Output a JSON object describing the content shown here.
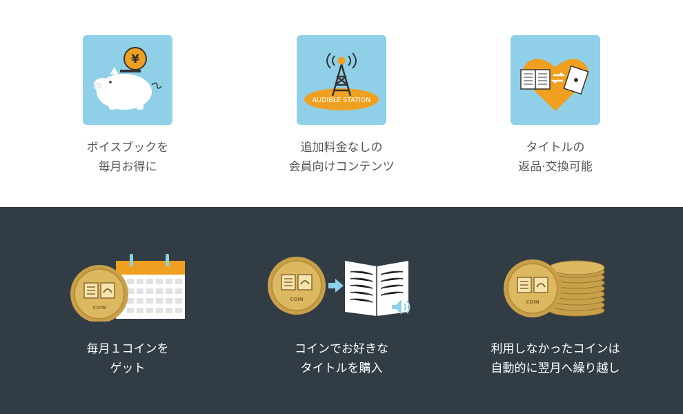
{
  "top_features": [
    {
      "line1": "ボイスブックを",
      "line2": "毎月お得に",
      "icon": "piggy-bank-icon",
      "coin_symbol": "¥"
    },
    {
      "line1": "追加料金なしの",
      "line2": "会員向けコンテンツ",
      "icon": "radio-tower-icon",
      "badge": "AUDIBLE STATION"
    },
    {
      "line1": "タイトルの",
      "line2": "返品·交換可能",
      "icon": "book-exchange-icon"
    }
  ],
  "bottom_features": [
    {
      "line1": "毎月１コインを",
      "line2": "ゲット",
      "icon": "coin-calendar-icon",
      "coin_text": "COIN"
    },
    {
      "line1": "コインでお好きな",
      "line2": "タイトルを購入",
      "icon": "coin-to-book-icon",
      "coin_text": "COIN"
    },
    {
      "line1": "利用しなかったコインは",
      "line2": "自動的に翌月へ繰り越し",
      "icon": "coin-stack-icon",
      "coin_text": "COIN"
    }
  ],
  "colors": {
    "tile_blue": "#8fd0e8",
    "orange": "#f0a020",
    "dark_bg": "#313c45",
    "gold": "#d8b25a"
  }
}
